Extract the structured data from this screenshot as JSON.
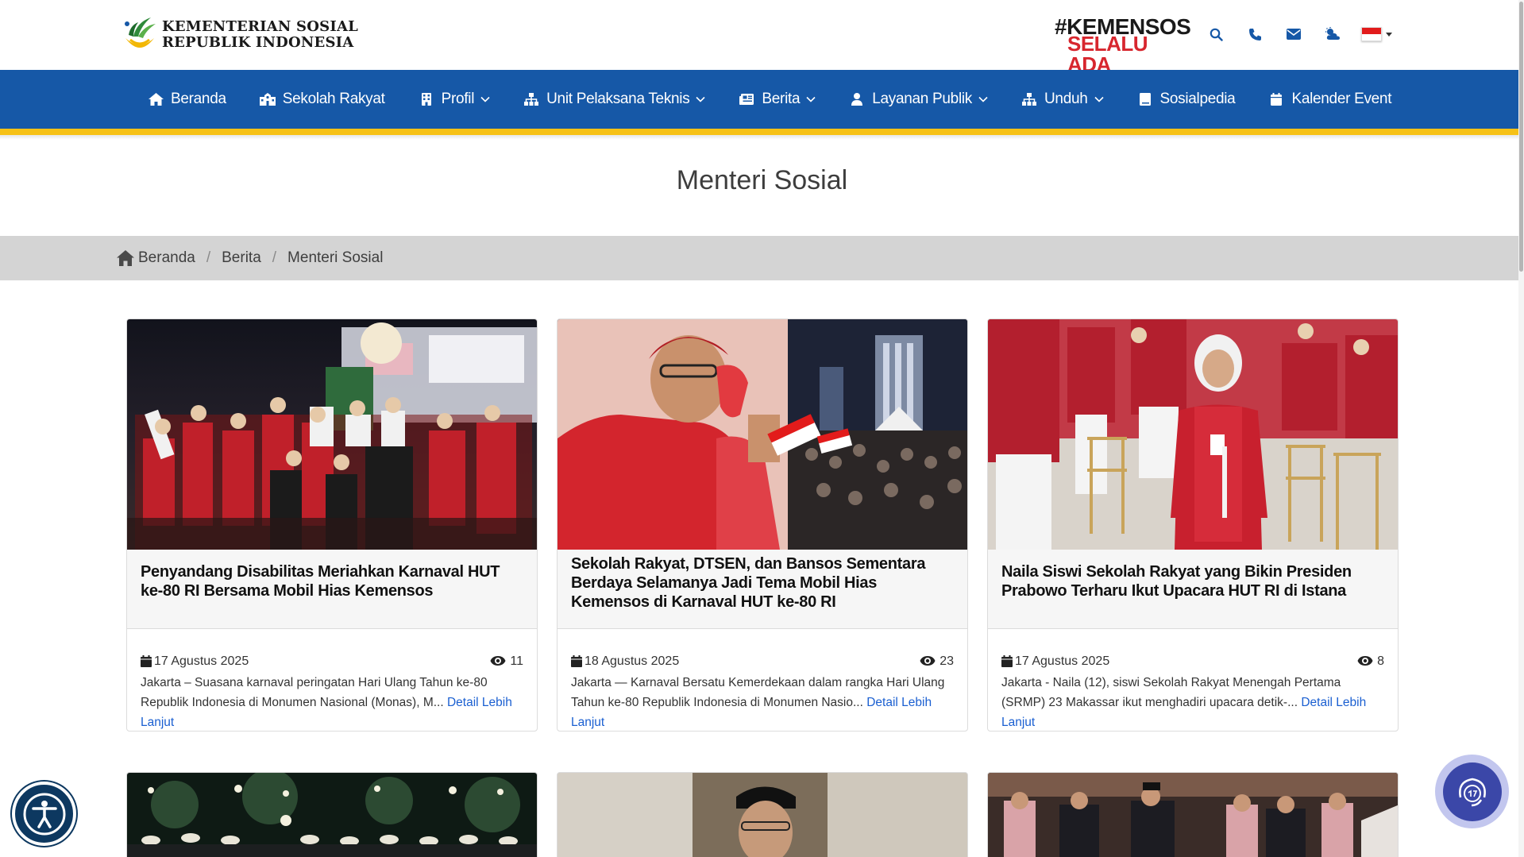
{
  "header": {
    "logo_line1": "KEMENTERIAN SOSIAL",
    "logo_line2": "REPUBLIK INDONESIA",
    "hashtag_line1": "#KEMENSOS",
    "hashtag_line2": "SELALU ADA",
    "icons": [
      "search-icon",
      "phone-icon",
      "mail-icon",
      "weather-icon"
    ],
    "language_flag": "Indonesia"
  },
  "nav": {
    "items": [
      {
        "label": "Beranda",
        "icon": "home-icon"
      },
      {
        "label": "Sekolah Rakyat",
        "icon": "school-icon"
      },
      {
        "label": "Profil",
        "icon": "building-icon",
        "dropdown": true
      },
      {
        "label": "Unit Pelaksana Teknis",
        "icon": "sitemap-icon",
        "dropdown": true
      },
      {
        "label": "Berita",
        "icon": "newspaper-icon",
        "dropdown": true
      },
      {
        "label": "Layanan Publik",
        "icon": "user-icon",
        "dropdown": true
      },
      {
        "label": "Unduh",
        "icon": "download-icon",
        "dropdown": true
      },
      {
        "label": "Sosialpedia",
        "icon": "book-icon"
      },
      {
        "label": "Kalender Event",
        "icon": "calendar-icon"
      }
    ]
  },
  "page": {
    "title": "Menteri Sosial"
  },
  "breadcrumb": {
    "items": [
      "Beranda",
      "Berita",
      "Menteri Sosial"
    ],
    "separator": "/"
  },
  "articles": [
    {
      "title": "Penyandang Disabilitas Meriahkan Karnaval HUT ke-80 RI Bersama Mobil Hias Kemensos",
      "date": "17 Agustus 2025",
      "views": "11",
      "excerpt": "Jakarta – Suasana karnaval peringatan Hari Ulang Tahun ke-80 Republik Indonesia di Monumen Nasional (Monas), M...",
      "more": "Detail Lebih Lanjut"
    },
    {
      "title": "Sekolah Rakyat, DTSEN, dan Bansos Sementara Berdaya Selamanya Jadi Tema Mobil Hias Kemensos di Karnaval HUT ke-80 RI",
      "date": "18 Agustus 2025",
      "views": "23",
      "excerpt": "Jakarta — Karnaval Bersatu Kemerdekaan dalam rangka Hari Ulang Tahun ke-80 Republik Indonesia di Monumen Nasio...",
      "more": "Detail Lebih Lanjut"
    },
    {
      "title": "Naila Siswi Sekolah Rakyat yang Bikin Presiden Prabowo Terharu Ikut Upacara HUT RI di Istana",
      "date": "17 Agustus 2025",
      "views": "8",
      "excerpt": "Jakarta  - Naila (12), siswi Sekolah Rakyat Menengah Pertama (SRMP) 23 Makassar ikut menghadiri upacara detik-...",
      "more": "Detail Lebih Lanjut"
    }
  ],
  "colors": {
    "nav_blue": "#1658a7",
    "accent_yellow": "#f6c116",
    "link_blue": "#1a5fd1",
    "brand_red": "#d7262e"
  }
}
